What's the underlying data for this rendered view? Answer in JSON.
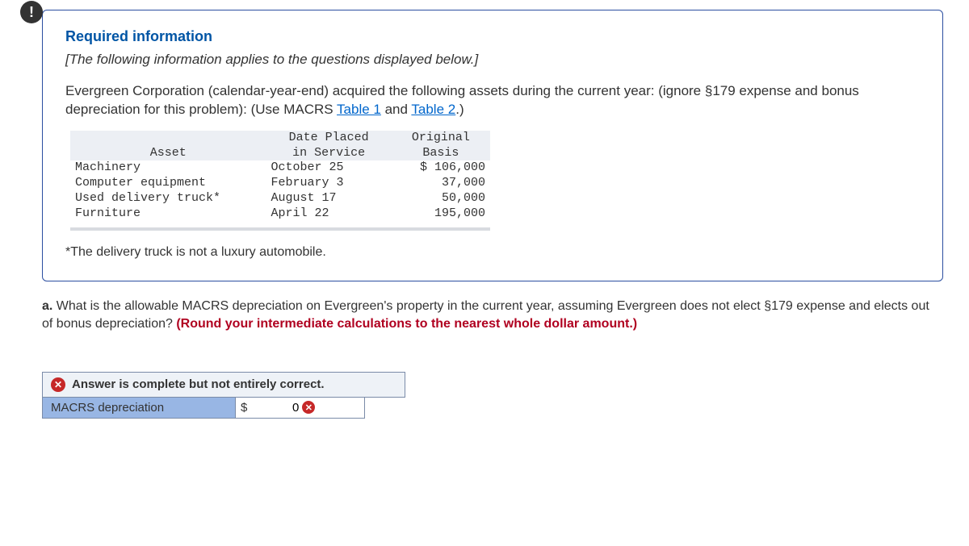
{
  "info": {
    "title": "Required information",
    "preface": "[The following information applies to the questions displayed below.]",
    "intro_pre": "Evergreen Corporation (calendar-year-end) acquired the following assets during the current year: (ignore §179 expense and bonus depreciation for this problem): (Use MACRS ",
    "link1": "Table 1",
    "mid": " and ",
    "link2": "Table 2",
    "intro_post": ".)",
    "footnote": "*The delivery truck is not a luxury automobile."
  },
  "table": {
    "headers": {
      "asset": "Asset",
      "date": "Date Placed\nin Service",
      "basis": "Original\nBasis"
    },
    "rows": [
      {
        "asset": "Machinery",
        "date": "October 25",
        "basis": "$ 106,000"
      },
      {
        "asset": "Computer equipment",
        "date": "February 3",
        "basis": "37,000"
      },
      {
        "asset": "Used delivery truck*",
        "date": "August 17",
        "basis": "50,000"
      },
      {
        "asset": "Furniture",
        "date": "April 22",
        "basis": "195,000"
      }
    ]
  },
  "question": {
    "label": "a.",
    "text": " What is the allowable MACRS depreciation on Evergreen's property in the current year, assuming Evergreen does not elect §179 expense and elects out of bonus depreciation? ",
    "round": "(Round your intermediate calculations to the nearest whole dollar amount.)"
  },
  "answer": {
    "banner": "Answer is complete but not entirely correct.",
    "label": "MACRS depreciation",
    "currency": "$",
    "value": "0"
  }
}
